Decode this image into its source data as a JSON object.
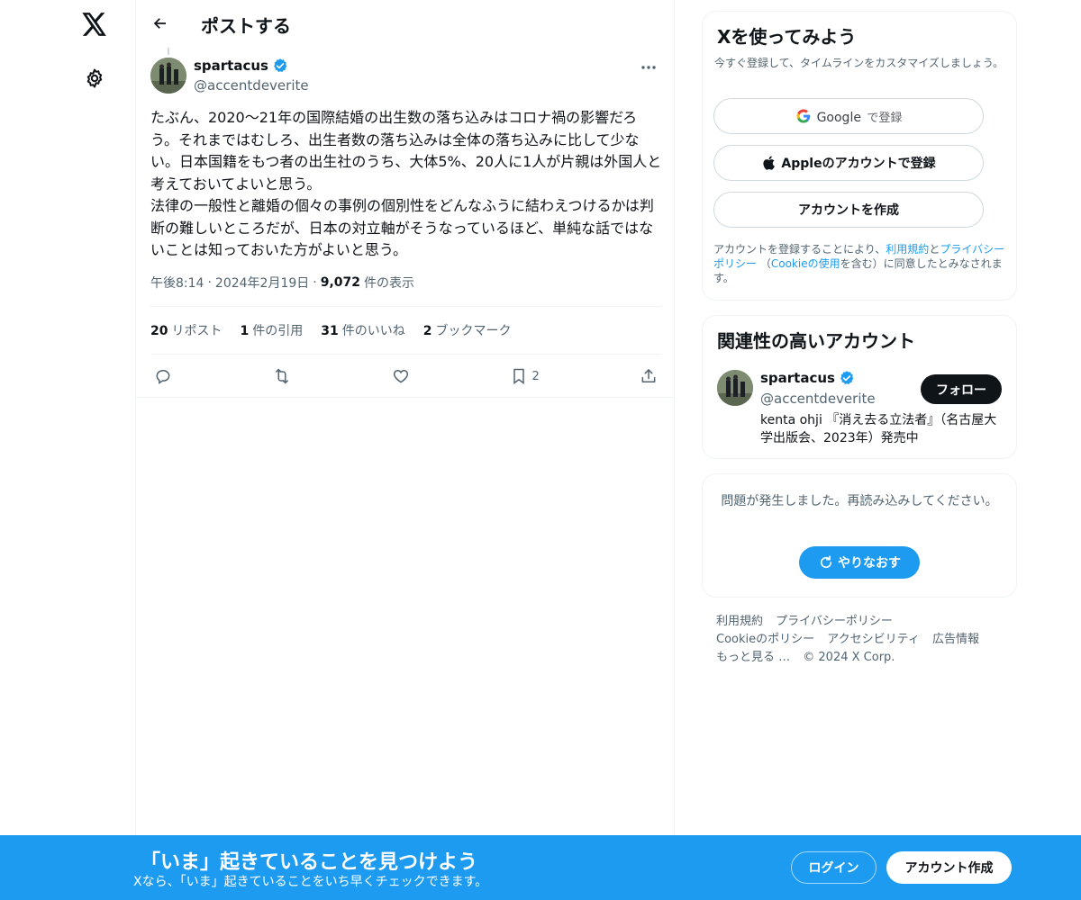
{
  "nav": {
    "logo_icon": "x-logo-icon",
    "settings_icon": "gear-icon"
  },
  "header": {
    "title": "ポストする"
  },
  "post": {
    "author_name": "spartacus",
    "author_handle": "@accentdeverite",
    "text": "たぶん、2020〜21年の国際結婚の出生数の落ち込みはコロナ禍の影響だろう。それまではむしろ、出生者数の落ち込みは全体の落ち込みに比して少ない。日本国籍をもつ者の出生社のうち、大体5%、20人に1人が片親は外国人と考えておいてよいと思う。\n法律の一般性と離婚の個々の事例の個別性をどんなふうに結わえつけるかは判断の難しいところだが、日本の対立軸がそうなっているほど、単純な話ではないことは知っておいた方がよいと思う。",
    "time": "午後8:14",
    "date": "2024年2月19日",
    "sep": "·",
    "views_count": "9,072",
    "views_label": "件の表示",
    "stats": [
      {
        "count": "20",
        "label": "リポスト"
      },
      {
        "count": "1",
        "label": "件の引用"
      },
      {
        "count": "31",
        "label": "件のいいね"
      },
      {
        "count": "2",
        "label": "ブックマーク"
      }
    ],
    "bookmark_count": "2"
  },
  "signup": {
    "title": "Xを使ってみよう",
    "subtitle": "今すぐ登録して、タイムラインをカスタマイズしましょう。",
    "google_brand": "Google",
    "google_suffix": "で登録",
    "apple_label": "Appleのアカウントで登録",
    "create_label": "アカウントを作成",
    "terms_prefix": "アカウントを登録することにより、",
    "terms_link": "利用規約",
    "terms_and": "と",
    "privacy_link": "プライバシーポリシー",
    "paren_open": "（",
    "cookie_link": "Cookieの使用",
    "terms_suffix": "を含む）に同意したとみなされます。"
  },
  "related": {
    "title": "関連性の高いアカウント",
    "name": "spartacus",
    "handle": "@accentdeverite",
    "follow_label": "フォロー",
    "bio": "kenta ohji 『消え去る立法者』（名古屋大学出版会、2023年）発売中"
  },
  "error_card": {
    "message": "問題が発生しました。再読み込みしてください。",
    "retry_label": "やりなおす"
  },
  "footer": {
    "links": [
      "利用規約",
      "プライバシーポリシー",
      "Cookieのポリシー",
      "アクセシビリティ",
      "広告情報",
      "もっと見る …",
      "© 2024 X Corp."
    ]
  },
  "banner": {
    "title": "「いま」起きていることを見つけよう",
    "subtitle": "Xなら、「いま」起きていることをいち早くチェックできます。",
    "login_label": "ログイン",
    "create_label": "アカウント作成"
  },
  "colors": {
    "accent": "#1d9bf0",
    "text": "#0f1419",
    "muted": "#536471",
    "border": "#eff3f4"
  }
}
